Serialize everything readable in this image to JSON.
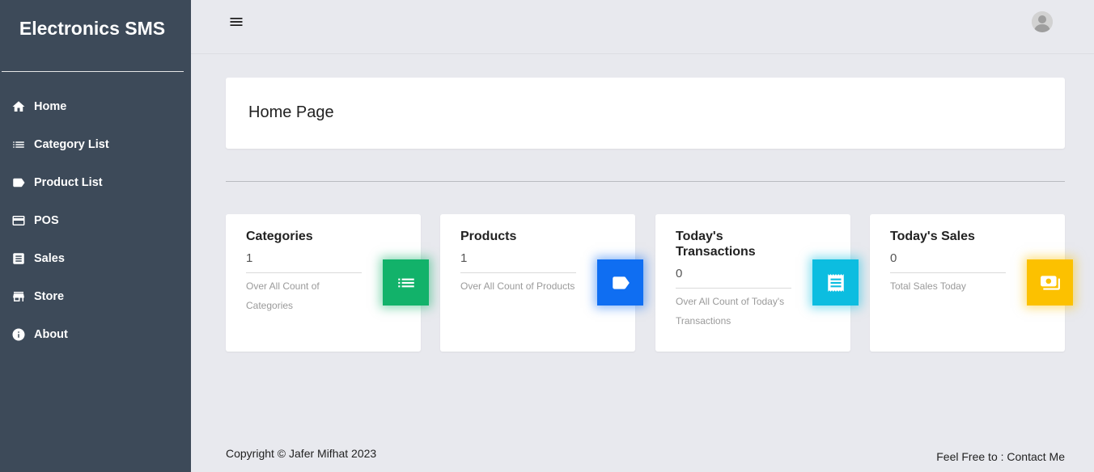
{
  "app": {
    "brand": "Electronics SMS"
  },
  "sidebar": {
    "items": [
      {
        "label": "Home",
        "icon": "home-icon"
      },
      {
        "label": "Category List",
        "icon": "list-icon"
      },
      {
        "label": "Product List",
        "icon": "tag-icon"
      },
      {
        "label": "POS",
        "icon": "credit-card-icon"
      },
      {
        "label": "Sales",
        "icon": "receipt-icon"
      },
      {
        "label": "Store",
        "icon": "store-icon"
      },
      {
        "label": "About",
        "icon": "info-icon"
      }
    ]
  },
  "header": {
    "menu_icon": "hamburger-icon",
    "avatar_icon": "user-avatar-icon"
  },
  "main": {
    "page_title": "Home Page",
    "cards": [
      {
        "title": "Categories",
        "value": "1",
        "description": "Over All Count of Categories",
        "icon": "list-icon",
        "color": "#12b26a"
      },
      {
        "title": "Products",
        "value": "1",
        "description": "Over All Count of Products",
        "icon": "tag-icon",
        "color": "#0f6ef2"
      },
      {
        "title": "Today's Transactions",
        "value": "0",
        "description": "Over All Count of Today's Transactions",
        "icon": "receipt-icon",
        "color": "#0cbde0"
      },
      {
        "title": "Today's Sales",
        "value": "0",
        "description": "Total Sales Today",
        "icon": "money-icon",
        "color": "#fcc100"
      }
    ]
  },
  "footer": {
    "copyright": "Copyright © Jafer Mifhat 2023",
    "contact_prefix": "Feel Free to : ",
    "contact_link": "Contact Me"
  },
  "colors": {
    "sidebar_bg": "#3d4a59",
    "page_bg": "#e8e9ee"
  }
}
